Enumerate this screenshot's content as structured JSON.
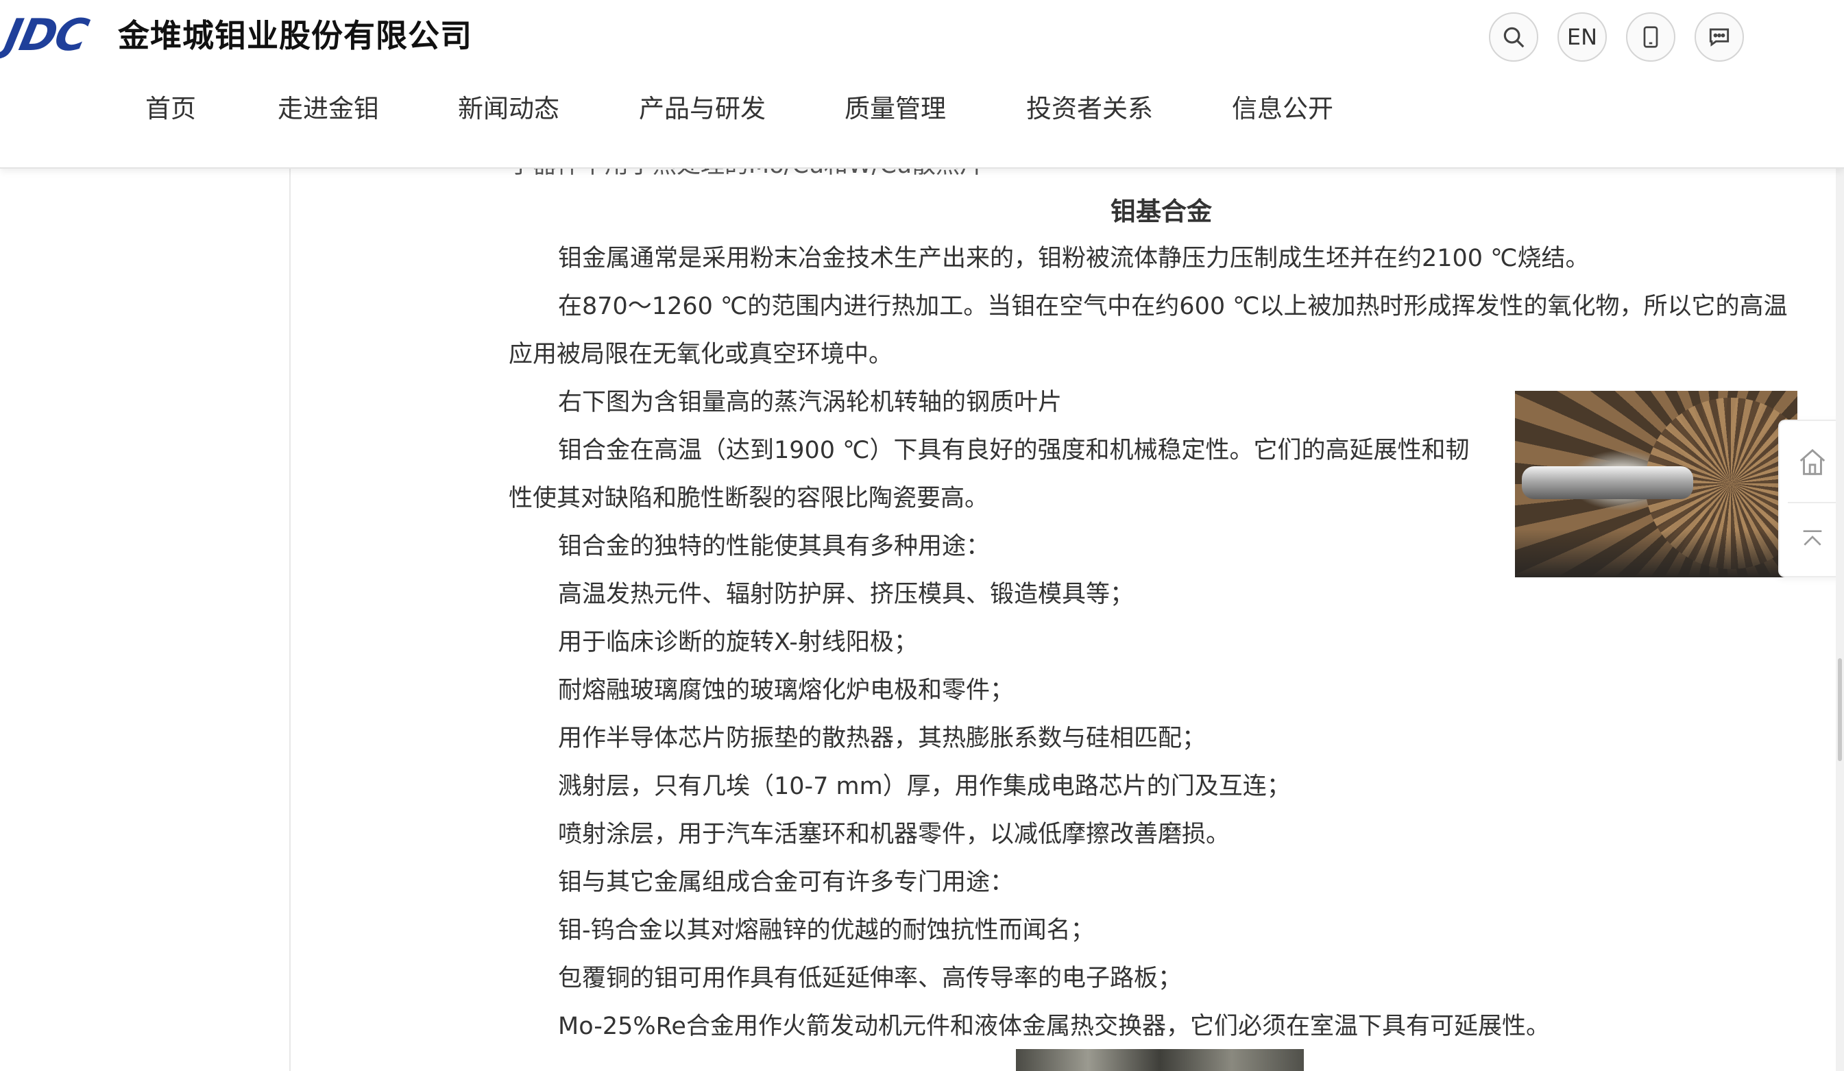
{
  "header": {
    "logo_text": "JDC",
    "company_name": "金堆城钼业股份有限公司",
    "tools": {
      "search_icon": "search-icon",
      "lang_label": "EN",
      "mobile_icon": "mobile-icon",
      "message_icon": "message-icon"
    },
    "nav": [
      {
        "label": "首页"
      },
      {
        "label": "走进金钼"
      },
      {
        "label": "新闻动态"
      },
      {
        "label": "产品与研发"
      },
      {
        "label": "质量管理"
      },
      {
        "label": "投资者关系"
      },
      {
        "label": "信息公开"
      }
    ]
  },
  "article": {
    "cut_line": "子器件中用于热处理的Mo/Cu和W/Cu散热片",
    "heading": "钼基合金",
    "paragraphs": [
      "钼金属通常是采用粉末冶金技术生产出来的，钼粉被流体静压力压制成生坯并在约2100 ℃烧结。",
      "在870～1260 ℃的范围内进行热加工。当钼在空气中在约600 ℃以上被加热时形成挥发性的氧化物，所以它的高温",
      "应用被局限在无氧化或真空环境中。",
      "右下图为含钼量高的蒸汽涡轮机转轴的钢质叶片",
      "钼合金在高温（达到1900 ℃）下具有良好的强度和机械稳定性。它们的高延展性和韧",
      "性使其对缺陷和脆性断裂的容限比陶瓷要高。",
      "钼合金的独特的性能使其具有多种用途：",
      "高温发热元件、辐射防护屏、挤压模具、锻造模具等；",
      "用于临床诊断的旋转X-射线阳极；",
      "耐熔融玻璃腐蚀的玻璃熔化炉电极和零件；",
      "用作半导体芯片防振垫的散热器，其热膨胀系数与硅相匹配；",
      "溅射层，只有几埃（10-7 mm）厚，用作集成电路芯片的门及互连；",
      "喷射涂层，用于汽车活塞环和机器零件，以减低摩擦改善磨损。",
      "钼与其它金属组成合金可有许多专门用途：",
      "钼-钨合金以其对熔融锌的优越的耐蚀抗性而闻名；",
      "包覆铜的钼可用作具有低延延伸率、高传导率的电子路板；",
      "Mo-25%Re合金用作火箭发动机元件和液体金属热交换器，它们必须在室温下具有可延展性。"
    ]
  },
  "side_tools": {
    "home_icon": "home-icon",
    "top_icon": "back-to-top-icon"
  },
  "colors": {
    "logo_blue": "#1f3f9a",
    "text": "#333333",
    "divider": "#e8e8e8"
  }
}
